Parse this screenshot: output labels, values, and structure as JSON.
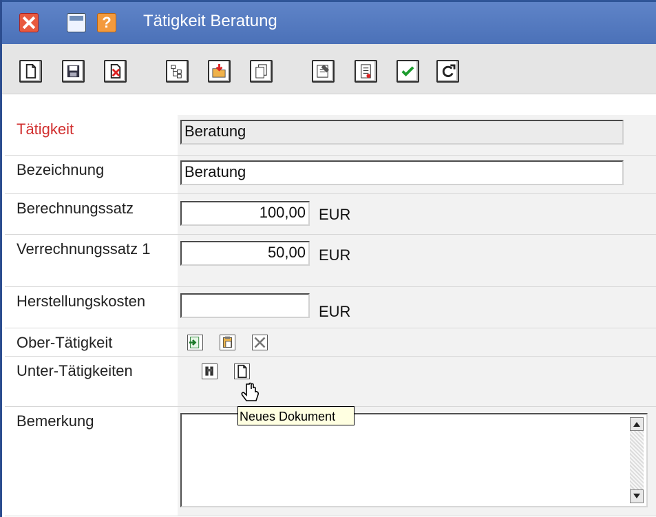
{
  "window": {
    "title": "Tätigkeit Beratung",
    "accent": "#4b71b8"
  },
  "form": {
    "fields": [
      {
        "label": "Tätigkeit",
        "value": "Beratung"
      },
      {
        "label": "Bezeichnung",
        "value": "Beratung"
      },
      {
        "label": "Berechnungssatz",
        "value": "100,00",
        "unit": "EUR"
      },
      {
        "label": "Verrechnungssatz 1",
        "value": "50,00",
        "unit": "EUR"
      },
      {
        "label": "Herstellungskosten",
        "value": "",
        "unit": "EUR"
      },
      {
        "label": "Ober-Tätigkeit"
      },
      {
        "label": "Unter-Tätigkeiten"
      },
      {
        "label": "Bemerkung",
        "value": ""
      }
    ]
  },
  "tooltip": {
    "text": "Neues Dokument"
  },
  "toolbar": {
    "icons": [
      "new-document-icon",
      "save-icon",
      "delete-icon",
      "structure-icon",
      "open-folder-icon",
      "copy-icon",
      "properties-icon",
      "document-list-icon",
      "check-icon",
      "refresh-icon"
    ]
  },
  "ober_actions": [
    "assign-icon",
    "paste-icon",
    "remove-icon"
  ],
  "unter_actions": [
    "search-icon",
    "new-document-icon"
  ]
}
